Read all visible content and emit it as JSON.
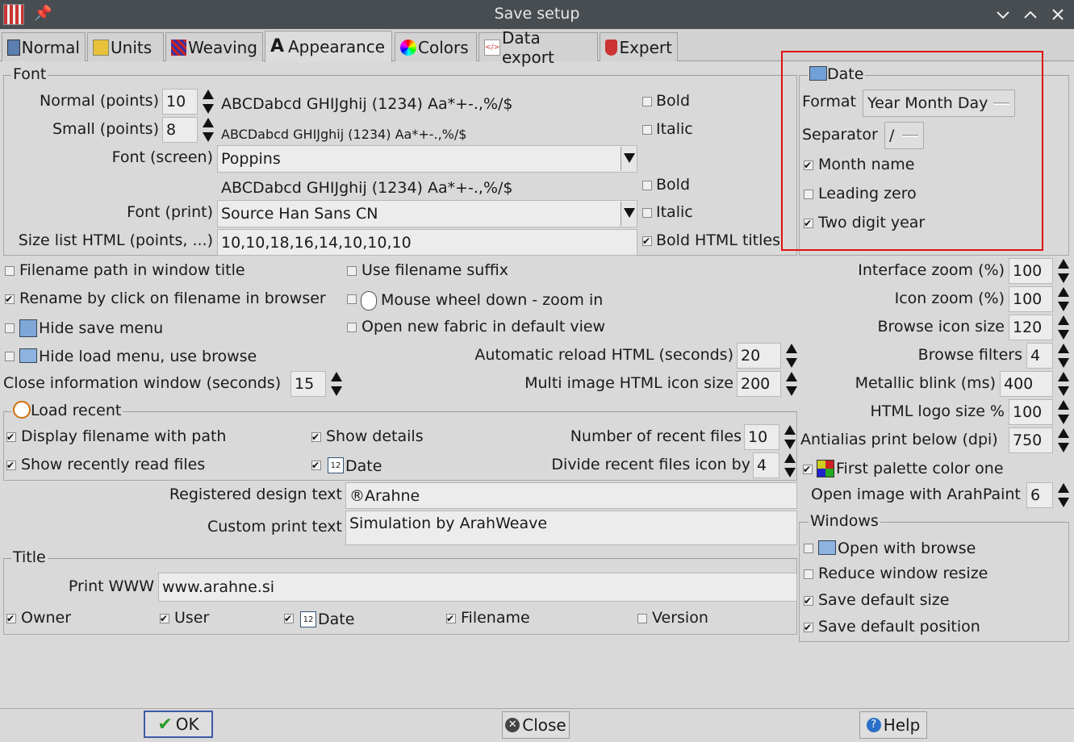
{
  "window": {
    "title": "Save setup"
  },
  "tabs": [
    {
      "label": "Normal"
    },
    {
      "label": "Units"
    },
    {
      "label": "Weaving"
    },
    {
      "label": "Appearance"
    },
    {
      "label": "Colors"
    },
    {
      "label": "Data export"
    },
    {
      "label": "Expert"
    }
  ],
  "font": {
    "group_title": "Font",
    "normal_label": "Normal (points)",
    "normal_value": "10",
    "normal_sample": "ABCDabcd GHIJghij (1234) Aa*+-.,%/$",
    "small_label": "Small (points)",
    "small_value": "8",
    "small_sample": "ABCDabcd GHIJghij (1234) Aa*+-.,%/$",
    "bold_label": "Bold",
    "italic_label": "Italic",
    "screen_label": "Font (screen)",
    "screen_value": "Poppins",
    "print_sample": "ABCDabcd GHIJghij (1234) Aa*+-.,%/$",
    "print_bold_label": "Bold",
    "print_label": "Font (print)",
    "print_value": "Source Han Sans CN",
    "print_italic_label": "Italic",
    "sizelist_label": "Size list HTML (points, ...)",
    "sizelist_value": "10,10,18,16,14,10,10,10",
    "bold_html_label": "Bold HTML titles"
  },
  "date": {
    "group_title": "Date",
    "format_label": "Format",
    "format_value": "Year Month Day",
    "separator_label": "Separator",
    "separator_value": "/",
    "month_name_label": "Month name",
    "leading_zero_label": "Leading zero",
    "two_digit_label": "Two digit year"
  },
  "options": {
    "filename_path": "Filename path in window title",
    "use_suffix": "Use filename suffix",
    "rename_click": "Rename by click on filename in browser",
    "mouse_wheel": "Mouse wheel down - zoom in",
    "hide_save": "Hide save menu",
    "open_new_fabric": "Open new fabric in default view",
    "hide_load": "Hide load menu, use browse",
    "auto_reload_label": "Automatic reload HTML (seconds)",
    "auto_reload_value": "20",
    "close_info_label": "Close information window (seconds)",
    "close_info_value": "15",
    "multi_image_label": "Multi image HTML icon size",
    "multi_image_value": "200"
  },
  "right": {
    "interface_zoom_label": "Interface zoom (%)",
    "interface_zoom_value": "100",
    "icon_zoom_label": "Icon zoom (%)",
    "icon_zoom_value": "100",
    "browse_icon_label": "Browse icon size",
    "browse_icon_value": "120",
    "browse_filters_label": "Browse filters",
    "browse_filters_value": "4",
    "metallic_label": "Metallic blink (ms)",
    "metallic_value": "400",
    "html_logo_label": "HTML logo size %",
    "html_logo_value": "100",
    "antialias_label": "Antialias print below (dpi)",
    "antialias_value": "750",
    "first_palette_label": "First palette color one",
    "arahpaint_label": "Open image with ArahPaint",
    "arahpaint_value": "6"
  },
  "recent": {
    "group_title": "Load recent",
    "display_path": "Display filename with path",
    "show_details": "Show details",
    "num_recent_label": "Number of recent files",
    "num_recent_value": "10",
    "show_recent": "Show recently read files",
    "date_label": "Date",
    "divide_label": "Divide recent files icon by",
    "divide_value": "4"
  },
  "texts": {
    "registered_label": "Registered design text",
    "registered_value": "®Arahne",
    "custom_label": "Custom print text",
    "custom_value": "Simulation by ArahWeave"
  },
  "windows": {
    "group_title": "Windows",
    "open_browse": "Open with browse",
    "reduce_resize": "Reduce window resize",
    "save_size": "Save default size",
    "save_position": "Save default position"
  },
  "title": {
    "group_title": "Title",
    "www_label": "Print WWW",
    "www_value": "www.arahne.si",
    "owner": "Owner",
    "user": "User",
    "date": "Date",
    "filename": "Filename",
    "version": "Version"
  },
  "buttons": {
    "ok": "OK",
    "close": "Close",
    "help": "Help"
  },
  "colors": {
    "titlebar": "#484d52",
    "highlight": "#e01010",
    "ok_check": "#2a9a2a"
  }
}
